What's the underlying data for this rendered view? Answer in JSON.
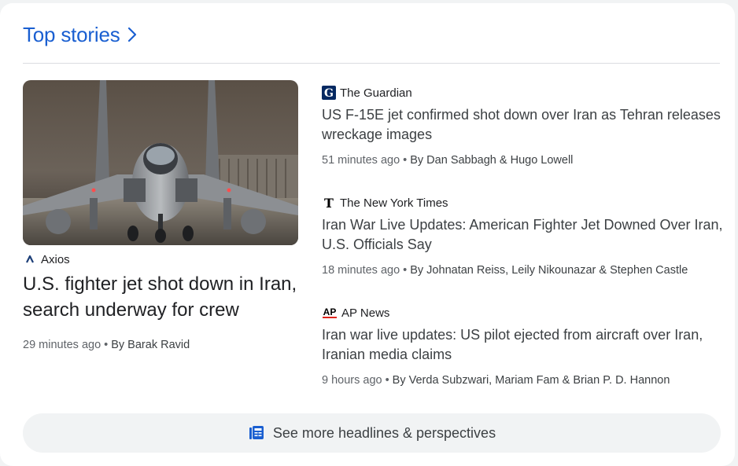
{
  "header": {
    "title": "Top stories",
    "accent": "#1a5fd1"
  },
  "lead": {
    "source": "Axios",
    "title": "U.S. fighter jet shot down in Iran, search underway for crew",
    "time": "29 minutes ago",
    "byline": "By Barak Ravid"
  },
  "stories": [
    {
      "source": "The Guardian",
      "source_icon": "guardian-logo-icon",
      "title": "US F-15E jet confirmed shot down over Iran as Tehran releases wreckage images",
      "time": "51 minutes ago",
      "byline": "By Dan Sabbagh & Hugo Lowell"
    },
    {
      "source": "The New York Times",
      "source_icon": "nyt-logo-icon",
      "title": "Iran War Live Updates: American Fighter Jet Downed Over Iran, U.S. Officials Say",
      "time": "18 minutes ago",
      "byline": "By Johnatan Reiss, Leily Nikounazar & Stephen Castle"
    },
    {
      "source": "AP News",
      "source_icon": "ap-logo-icon",
      "title": "Iran war live updates: US pilot ejected from aircraft over Iran, Iranian media claims",
      "time": "9 hours ago",
      "byline": "By Verda Subzwari, Mariam Fam & Brian P. D. Hannon"
    }
  ],
  "more_button": {
    "label": "See more headlines & perspectives",
    "icon": "newspaper-icon"
  },
  "logos": {
    "guardian": "G",
    "nyt": "𝕿",
    "ap": "AP",
    "axios": "ʌ"
  },
  "meta_separator": "•"
}
